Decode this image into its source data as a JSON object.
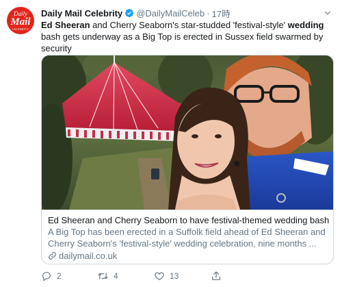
{
  "tweet": {
    "avatar": {
      "line1": "Daily",
      "line2": "Mail",
      "line3": "CELEBRITY"
    },
    "display_name": "Daily Mail Celebrity",
    "handle": "@DailyMailCeleb",
    "separator": "·",
    "time": "17時",
    "text": {
      "part1": "Ed Sheeran",
      "part2": " and Cherry Seaborn's star-studded 'festival-style' ",
      "part3": "wedding",
      "part4": " bash gets underway as a Big Top is erected in Sussex field swarmed by security"
    },
    "card": {
      "title": "Ed Sheeran and Cherry Seaborn to have festival-themed wedding bash",
      "desc_line1": "A Big Top has been erected in a Suffolk field ahead of Ed Sheeran and",
      "desc_line2": "Cherry Seaborn's 'festival-style' wedding celebration, nine months ...",
      "domain": "dailymail.co.uk"
    },
    "actions": {
      "replies": "2",
      "retweets": "4",
      "likes": "13"
    }
  },
  "colors": {
    "brand_red": "#e1251b",
    "verified_blue": "#1da1f2",
    "secondary_text": "#657786",
    "primary_text": "#14171a",
    "border": "#ccd6dd"
  },
  "icons": [
    "verified-icon",
    "caret-down-icon",
    "link-icon",
    "reply-icon",
    "retweet-icon",
    "like-icon",
    "share-icon"
  ]
}
